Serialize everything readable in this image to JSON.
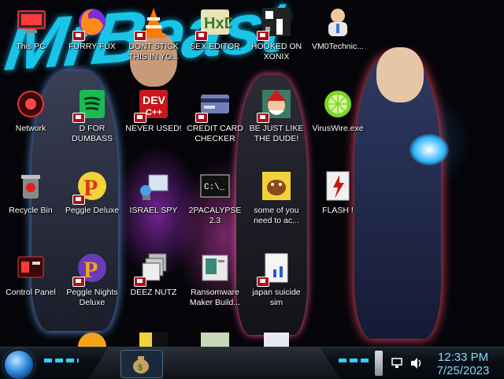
{
  "desktop": {
    "icons": [
      {
        "id": "this-pc",
        "label": "This PC",
        "icon": "computer-icon"
      },
      {
        "id": "furry-fux",
        "label": "FURRY FUX",
        "icon": "firefox-icon"
      },
      {
        "id": "dont-stick",
        "label": "DONT STICK THIS IN YO...",
        "icon": "vlc-cone-icon"
      },
      {
        "id": "sex-editor",
        "label": "SEX EDITOR",
        "icon": "hxd-icon"
      },
      {
        "id": "hooked-on-xonix",
        "label": "HOOKED ON XONIX",
        "icon": "xonix-icon"
      },
      {
        "id": "vm0technic",
        "label": "VM0Technic...",
        "icon": "doctor-icon"
      },
      {
        "id": "network",
        "label": "Network",
        "icon": "network-icon"
      },
      {
        "id": "d-for-dumbass",
        "label": "D FOR DUMBASS",
        "icon": "spotify-icon"
      },
      {
        "id": "never-used",
        "label": "NEVER USED!",
        "icon": "dev-icon"
      },
      {
        "id": "credit-card-checker",
        "label": "CREDIT CARD CHECKER",
        "icon": "credit-card-icon"
      },
      {
        "id": "be-just-like",
        "label": "BE JUST LIKE THE DUDE!",
        "icon": "santa-icon"
      },
      {
        "id": "viruswire",
        "label": "VirusWire.exe",
        "icon": "lime-icon"
      },
      {
        "id": "recycle-bin",
        "label": "Recycle Bin",
        "icon": "recycle-bin-icon"
      },
      {
        "id": "peggle-deluxe",
        "label": "Peggle Deluxe",
        "icon": "peggle-icon"
      },
      {
        "id": "israel-spy",
        "label": "ISRAEL SPY",
        "icon": "spy-icon"
      },
      {
        "id": "2pacalypse",
        "label": "2PACALYPSE 2.3",
        "icon": "terminal-icon"
      },
      {
        "id": "some-of-you",
        "label": "some of you need to ac...",
        "icon": "beaver-icon"
      },
      {
        "id": "flash",
        "label": "FLASH !",
        "icon": "flash-icon"
      },
      {
        "id": "control-panel",
        "label": "Control Panel",
        "icon": "control-panel-icon"
      },
      {
        "id": "peggle-nights",
        "label": "Peggle Nights Deluxe",
        "icon": "peggle-icon"
      },
      {
        "id": "deez-nutz",
        "label": "DEEZ NUTZ",
        "icon": "windows-stack-icon"
      },
      {
        "id": "ransomware-maker",
        "label": "Ransomware Maker Build...",
        "icon": "ransomware-icon"
      },
      {
        "id": "japan-suicide-sim",
        "label": "japan suicide sim",
        "icon": "japan-icon"
      }
    ]
  },
  "taskbar": {
    "clock_time": "12:33 PM",
    "clock_date": "7/25/2023",
    "tray": [
      "network-icon",
      "speaker-icon"
    ],
    "task_button_icon": "money-bag-icon"
  },
  "colors": {
    "wallpaper_accent": "#19c4e6",
    "clock_text": "#7fd8ff",
    "badge_red": "#b0101a"
  }
}
